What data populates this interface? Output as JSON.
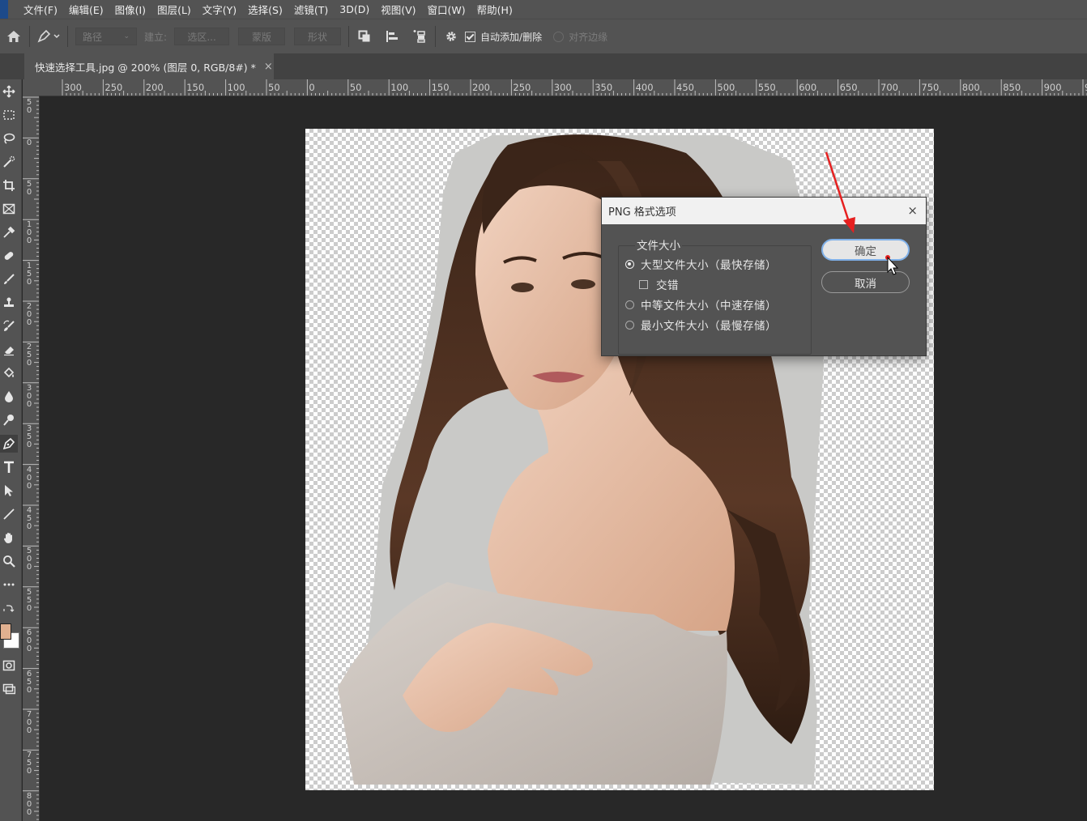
{
  "menu": {
    "items": [
      "文件(F)",
      "编辑(E)",
      "图像(I)",
      "图层(L)",
      "文字(Y)",
      "选择(S)",
      "滤镜(T)",
      "3D(D)",
      "视图(V)",
      "窗口(W)",
      "帮助(H)"
    ]
  },
  "options": {
    "path_mode": "路径",
    "make_label": "建立:",
    "selection_btn": "选区...",
    "mask_btn": "蒙版",
    "shape_btn": "形状",
    "auto_add_delete": "自动添加/删除",
    "auto_add_delete_checked": true,
    "align_edges": "对齐边缘",
    "align_edges_checked": false
  },
  "document": {
    "tab_title": "快速选择工具.jpg @ 200% (图层 0, RGB/8#) *",
    "tab_close": "×"
  },
  "rulers": {
    "horizontal": [
      "300",
      "250",
      "200",
      "150",
      "100",
      "50",
      "0",
      "50",
      "100",
      "150",
      "200",
      "250",
      "300",
      "350",
      "400",
      "450",
      "500",
      "550",
      "600",
      "650",
      "700",
      "750",
      "800",
      "850",
      "900",
      "9"
    ],
    "vertical": [
      "5 0",
      "0",
      "5 0",
      "1 0 0",
      "1 5 0",
      "2 0 0",
      "2 5 0",
      "3 0 0",
      "3 5 0",
      "4 0 0",
      "4 5 0",
      "5 0 0",
      "5 5 0",
      "6 0 0",
      "6 5 0",
      "7 0 0",
      "7 5 0",
      "8 0 0"
    ]
  },
  "colors": {
    "foreground": "#e0b090",
    "background": "#ffffff"
  },
  "dialog": {
    "title": "PNG 格式选项",
    "close": "×",
    "group_label": "文件大小",
    "option_large": "大型文件大小（最快存储）",
    "option_interlaced": "交错",
    "option_medium": "中等文件大小（中速存储）",
    "option_small": "最小文件大小（最慢存储）",
    "selected_option": "large",
    "interlaced_checked": false,
    "ok_label": "确定",
    "cancel_label": "取消"
  }
}
